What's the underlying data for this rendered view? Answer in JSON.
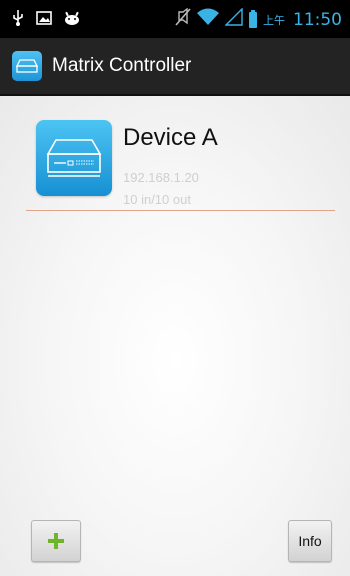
{
  "status_bar": {
    "ampm": "上午",
    "time": "11:50",
    "icons": [
      "usb-icon",
      "screenshot-icon",
      "android-debug-icon",
      "mute-icon",
      "wifi-icon",
      "signal-icon",
      "battery-icon"
    ]
  },
  "action_bar": {
    "title": "Matrix Controller",
    "app_icon": "matrix-device-icon"
  },
  "devices": [
    {
      "name": "Device A",
      "ip": "192.168.1.20",
      "io": "10 in/10 out",
      "icon": "matrix-device-icon"
    }
  ],
  "buttons": {
    "add_icon": "plus-icon",
    "info_label": "Info"
  },
  "colors": {
    "accent": "#39b3e6",
    "divider": "#e0a48a",
    "plus_green": "#6fb52c",
    "action_bar_bg": "#232323"
  }
}
